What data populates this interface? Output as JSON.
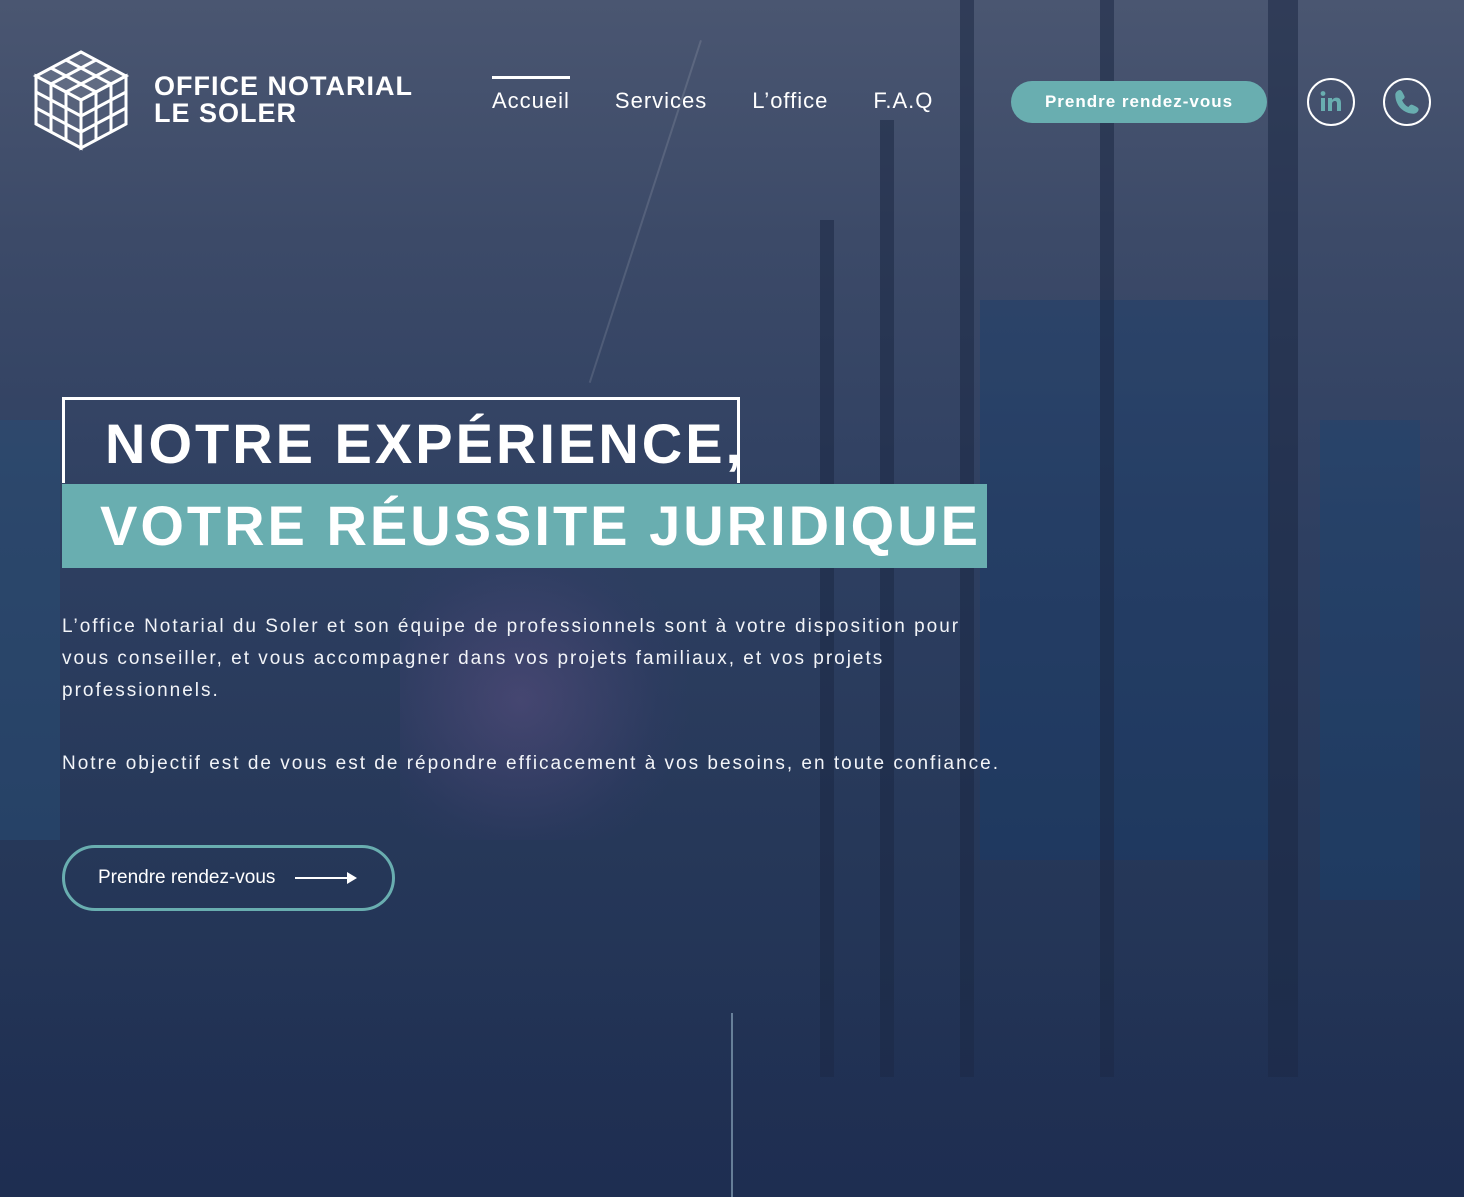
{
  "brand": {
    "line1": "OFFICE NOTARIAL",
    "line2": "LE SOLER",
    "logo_icon": "rubiks-cube-icon"
  },
  "nav": {
    "items": [
      {
        "label": "Accueil",
        "active": true
      },
      {
        "label": "Services",
        "active": false
      },
      {
        "label": "L’office",
        "active": false
      },
      {
        "label": "F.A.Q",
        "active": false
      }
    ],
    "cta_label": "Prendre rendez-vous",
    "social_icons": [
      "linkedin-icon",
      "phone-icon"
    ]
  },
  "hero": {
    "title_line1": "NOTRE EXPÉRIENCE,",
    "title_line2": "VOTRE RÉUSSITE JURIDIQUE",
    "paragraph1": "L’office Notarial du Soler et son équipe de professionnels sont à votre disposition pour vous conseiller, et vous accompagner dans vos projets familiaux, et vos projets professionnels.",
    "paragraph2": "Notre objectif est de vous est de répondre efficacement à vos besoins, en toute confiance.",
    "cta_label": "Prendre rendez-vous",
    "cta_icon": "arrow-right-icon"
  },
  "colors": {
    "accent": "#69aeb0",
    "background": "#2e3f61",
    "text": "#ffffff"
  }
}
